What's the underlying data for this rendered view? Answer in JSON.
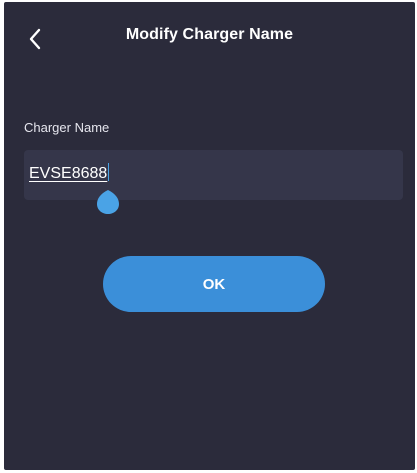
{
  "header": {
    "back_icon": "chevron-left-icon",
    "title": "Modify Charger Name"
  },
  "form": {
    "label": "Charger Name",
    "value": "EVSE8688"
  },
  "actions": {
    "ok_label": "OK"
  },
  "colors": {
    "background": "#2b2b3b",
    "input_background": "#35364a",
    "accent": "#3b8fd9",
    "caret": "#4aa3e6"
  }
}
